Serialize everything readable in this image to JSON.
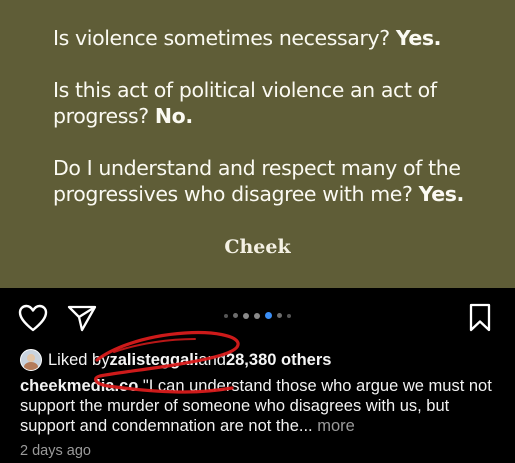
{
  "post": {
    "line1_text": "Is violence sometimes necessary? ",
    "line1_bold": "Yes.",
    "line2_text_a": "Is this act of political violence an act of",
    "line2_text_b": "progress? ",
    "line2_bold": "No.",
    "line3_text_a": "Do I understand and respect many of the",
    "line3_text_b": "progressives who disagree with me? ",
    "line3_bold": "Yes.",
    "brand": "Cheek"
  },
  "carousel": {
    "count": 7,
    "active_index": 4
  },
  "likes": {
    "prefix": "Liked by ",
    "user": "zalisteggali",
    "middle": " and ",
    "count": "28,380 others"
  },
  "caption": {
    "username": "cheekmedia.co",
    "text": " \"I can understand those who argue we must not support the murder of someone who disagrees with us, but support and condemnation are not the... ",
    "more": "more"
  },
  "timestamp": "2 days ago",
  "colors": {
    "background": "#5f5d37",
    "accent": "#3a8ef6",
    "annotation": "#d81b1b"
  },
  "icons": [
    "heart-icon",
    "send-icon",
    "bookmark-icon"
  ]
}
